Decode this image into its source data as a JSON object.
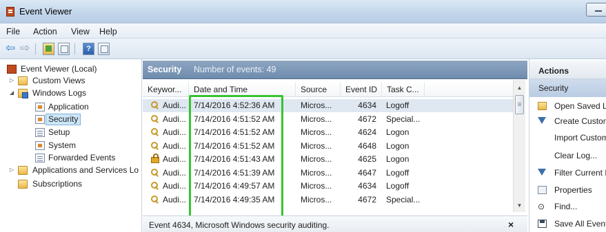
{
  "window": {
    "title": "Event Viewer"
  },
  "menu": [
    "File",
    "Action",
    "View",
    "Help"
  ],
  "toolbar": {
    "back": "⇦",
    "forward": "⇨",
    "help": "?"
  },
  "tree": [
    {
      "label": "Event Viewer (Local)",
      "icon": "event-viewer-icon"
    },
    {
      "label": "Custom Views",
      "icon": "folder-icon"
    },
    {
      "label": "Windows Logs",
      "icon": "folder-icon"
    },
    {
      "label": "Application",
      "icon": "log-icon"
    },
    {
      "label": "Security",
      "icon": "log-icon",
      "selected": true
    },
    {
      "label": "Setup",
      "icon": "log-icon"
    },
    {
      "label": "System",
      "icon": "log-icon"
    },
    {
      "label": "Forwarded Events",
      "icon": "log-icon"
    },
    {
      "label": "Applications and Services Lo",
      "icon": "folder-icon"
    },
    {
      "label": "Subscriptions",
      "icon": "folder-icon"
    }
  ],
  "center": {
    "title": "Security",
    "count_label": "Number of events: 49",
    "columns": [
      "Keywor...",
      "Date and Time",
      "Source",
      "Event ID",
      "Task C..."
    ],
    "rows": [
      {
        "keyword": "Audi...",
        "icon": "key",
        "date": "7/14/2016 4:52:36 AM",
        "source": "Micros...",
        "event_id": "4634",
        "task": "Logoff"
      },
      {
        "keyword": "Audi...",
        "icon": "key",
        "date": "7/14/2016 4:51:52 AM",
        "source": "Micros...",
        "event_id": "4672",
        "task": "Special..."
      },
      {
        "keyword": "Audi...",
        "icon": "key",
        "date": "7/14/2016 4:51:52 AM",
        "source": "Micros...",
        "event_id": "4624",
        "task": "Logon"
      },
      {
        "keyword": "Audi...",
        "icon": "key",
        "date": "7/14/2016 4:51:52 AM",
        "source": "Micros...",
        "event_id": "4648",
        "task": "Logon"
      },
      {
        "keyword": "Audi...",
        "icon": "lock",
        "date": "7/14/2016 4:51:43 AM",
        "source": "Micros...",
        "event_id": "4625",
        "task": "Logon"
      },
      {
        "keyword": "Audi...",
        "icon": "key",
        "date": "7/14/2016 4:51:39 AM",
        "source": "Micros...",
        "event_id": "4647",
        "task": "Logoff"
      },
      {
        "keyword": "Audi...",
        "icon": "key",
        "date": "7/14/2016 4:49:57 AM",
        "source": "Micros...",
        "event_id": "4634",
        "task": "Logoff"
      },
      {
        "keyword": "Audi...",
        "icon": "key",
        "date": "7/14/2016 4:49:35 AM",
        "source": "Micros...",
        "event_id": "4672",
        "task": "Special..."
      }
    ],
    "description": "Event 4634, Microsoft Windows security auditing.",
    "close": "×"
  },
  "actions": {
    "header": "Actions",
    "section": "Security",
    "items": [
      {
        "label": "Open Saved Lo",
        "icon": "folder-open-icon"
      },
      {
        "label": "Create Custom",
        "icon": "filter-icon"
      },
      {
        "label": "Import Custom",
        "icon": ""
      },
      {
        "label": "Clear Log...",
        "icon": ""
      },
      {
        "label": "Filter Current L",
        "icon": "filter-icon"
      },
      {
        "label": "Properties",
        "icon": "properties-icon"
      },
      {
        "label": "Find...",
        "icon": "find-icon"
      },
      {
        "label": "Save All Events",
        "icon": "save-icon"
      }
    ]
  },
  "colors": {
    "highlight_box": "#35c42f",
    "header_blue": "#7a94b4"
  }
}
